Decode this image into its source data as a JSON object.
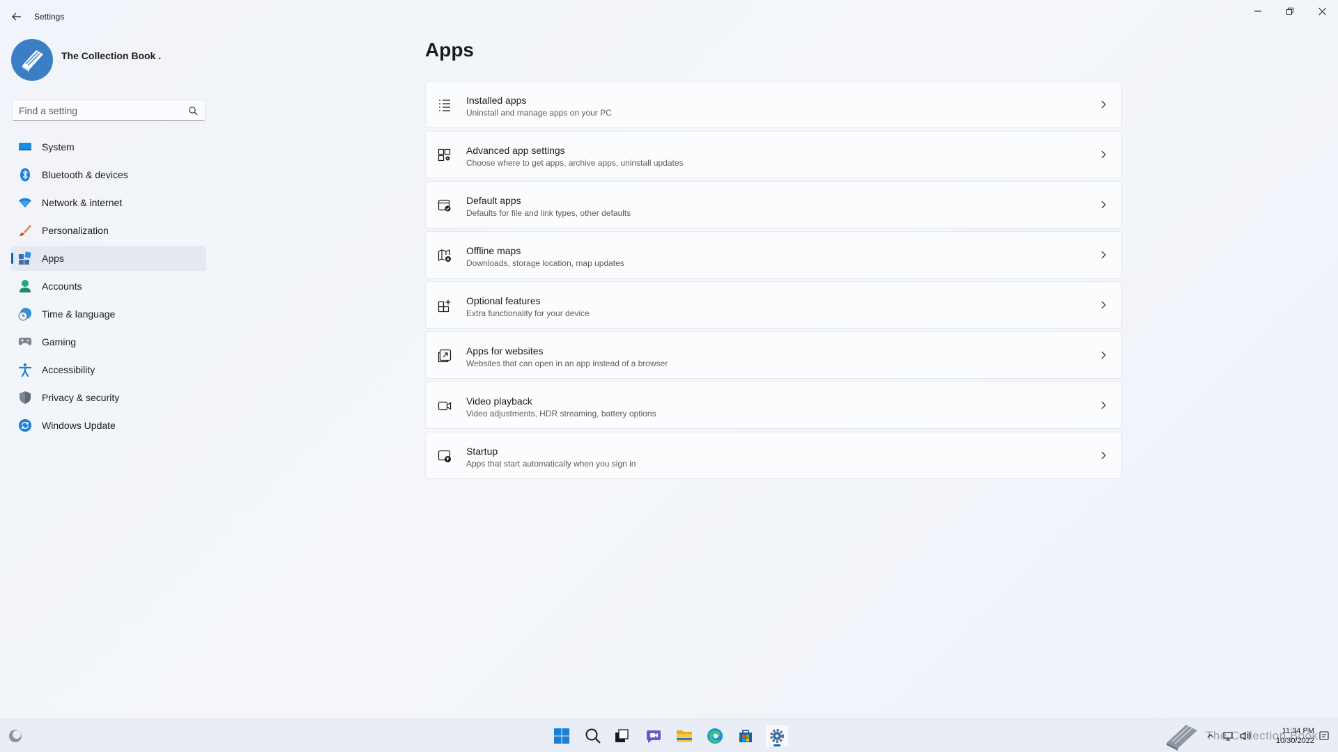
{
  "window": {
    "title": "Settings",
    "controls": {
      "minimize": "minimize-icon",
      "maximize": "restore-icon",
      "close": "close-icon"
    }
  },
  "profile": {
    "name": "The Collection Book ."
  },
  "search": {
    "placeholder": "Find a setting",
    "value": ""
  },
  "sidebar": {
    "items": [
      {
        "label": "System",
        "icon": "system-icon"
      },
      {
        "label": "Bluetooth & devices",
        "icon": "bluetooth-icon"
      },
      {
        "label": "Network & internet",
        "icon": "wifi-icon"
      },
      {
        "label": "Personalization",
        "icon": "brush-icon"
      },
      {
        "label": "Apps",
        "icon": "apps-icon",
        "active": true
      },
      {
        "label": "Accounts",
        "icon": "person-icon"
      },
      {
        "label": "Time & language",
        "icon": "globe-clock-icon"
      },
      {
        "label": "Gaming",
        "icon": "gamepad-icon"
      },
      {
        "label": "Accessibility",
        "icon": "accessibility-icon"
      },
      {
        "label": "Privacy & security",
        "icon": "shield-icon"
      },
      {
        "label": "Windows Update",
        "icon": "update-icon"
      }
    ]
  },
  "main": {
    "title": "Apps",
    "cards": [
      {
        "title": "Installed apps",
        "desc": "Uninstall and manage apps on your PC",
        "icon": "list-icon"
      },
      {
        "title": "Advanced app settings",
        "desc": "Choose where to get apps, archive apps, uninstall updates",
        "icon": "app-settings-icon"
      },
      {
        "title": "Default apps",
        "desc": "Defaults for file and link types, other defaults",
        "icon": "default-apps-icon"
      },
      {
        "title": "Offline maps",
        "desc": "Downloads, storage location, map updates",
        "icon": "map-download-icon"
      },
      {
        "title": "Optional features",
        "desc": "Extra functionality for your device",
        "icon": "grid-add-icon"
      },
      {
        "title": "Apps for websites",
        "desc": "Websites that can open in an app instead of a browser",
        "icon": "open-external-icon"
      },
      {
        "title": "Video playback",
        "desc": "Video adjustments, HDR streaming, battery options",
        "icon": "video-icon"
      },
      {
        "title": "Startup",
        "desc": "Apps that start automatically when you sign in",
        "icon": "startup-icon"
      }
    ]
  },
  "taskbar": {
    "apps": [
      "windows-start-icon",
      "search-icon",
      "task-view-icon",
      "chat-icon",
      "file-explorer-icon",
      "edge-icon",
      "store-icon",
      "settings-icon"
    ],
    "active_app": "settings-icon",
    "clock": {
      "time": "11:34 PM",
      "date": "10/30/2022"
    },
    "watermark": "The Collection Book"
  },
  "colors": {
    "accent": "#0067c0",
    "background": "#eef2f9",
    "card": "#fbfcfe"
  }
}
